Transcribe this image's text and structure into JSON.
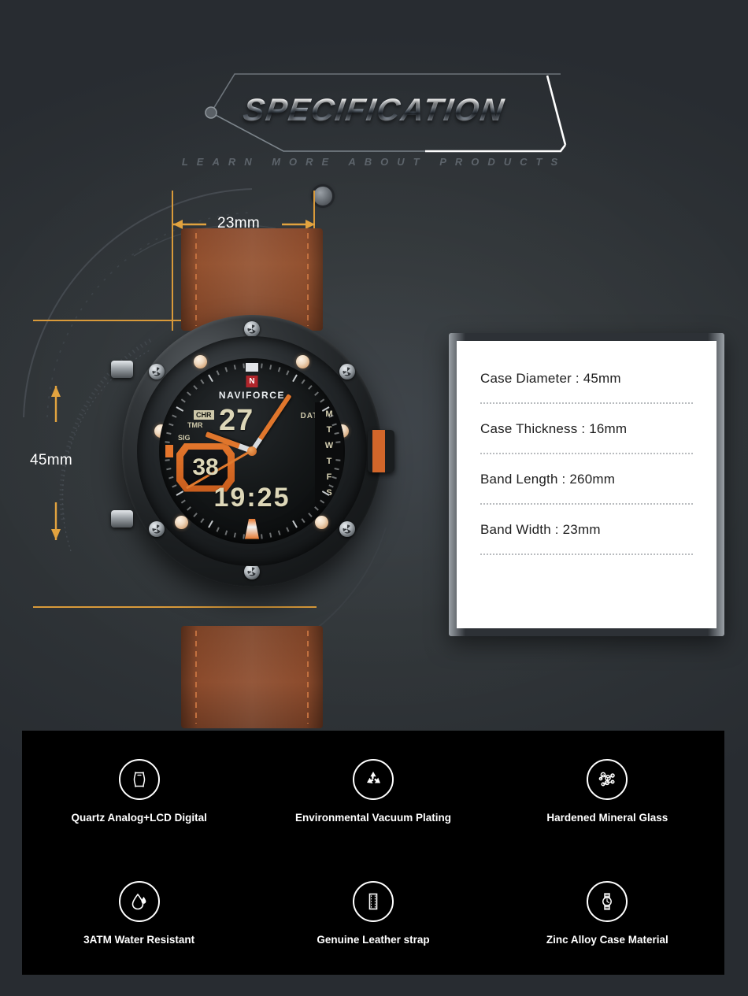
{
  "header": {
    "title": "SPECIFICATION",
    "subtitle": "LEARN MORE ABOUT PRODUCTS"
  },
  "dimensions": {
    "band_width_label": "23mm",
    "case_diameter_label": "45mm"
  },
  "watch": {
    "brand": "NAVIFORCE",
    "brand_mark": "N",
    "label_chr": "CHR",
    "label_tmr": "TMR",
    "label_sig": "SIG",
    "label_date": "DATE",
    "digital_date": "27",
    "sub_counter": "38",
    "digital_time": "19:25",
    "days": [
      "M",
      "T",
      "W",
      "T",
      "F",
      "S"
    ],
    "accent_color": "#e0762c",
    "strap_color": "#8a4a2c"
  },
  "specs": [
    {
      "text": "Case Diameter : 45mm"
    },
    {
      "text": "Case Thickness : 16mm"
    },
    {
      "text": "Band Length : 260mm"
    },
    {
      "text": "Band Width : 23mm"
    }
  ],
  "features": [
    {
      "icon": "watch-case-icon",
      "label": "Quartz Analog+LCD Digital"
    },
    {
      "icon": "recycle-icon",
      "label": "Environmental Vacuum Plating"
    },
    {
      "icon": "molecule-icon",
      "label": "Hardened Mineral Glass"
    },
    {
      "icon": "water-drop-icon",
      "label": "3ATM Water Resistant"
    },
    {
      "icon": "leather-strap-icon",
      "label": "Genuine Leather strap"
    },
    {
      "icon": "wristwatch-icon",
      "label": "Zinc Alloy Case Material"
    }
  ],
  "colors": {
    "background": "#282c31",
    "panel_black": "#000000",
    "guide_orange": "#d99a3a",
    "accent_orange": "#e0762c"
  }
}
